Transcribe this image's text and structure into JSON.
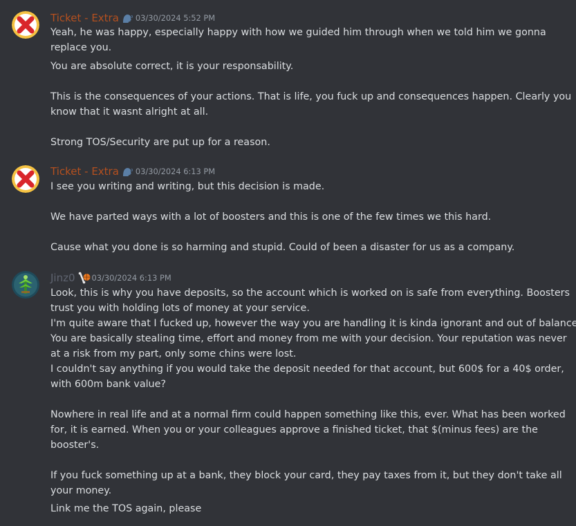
{
  "messages": [
    {
      "username": "Ticket - Extra",
      "username_color": "#b5501f",
      "timestamp": "03/30/2024 5:52 PM",
      "avatar_icon": "red-x-icon",
      "role_icon": "speaking-head-icon",
      "lines": [
        "Yeah, he was happy, especially happy with how we guided him through when we told him we gonna",
        "replace you.",
        "You are absolute correct, it is your responsability.",
        "",
        "This is the consequences of your actions. That is life, you fuck up and consequences happen. Clearly you",
        "know that it wasnt alright at all.",
        "",
        "Strong TOS/Security are put up for a reason."
      ]
    },
    {
      "username": "Ticket - Extra",
      "username_color": "#b5501f",
      "timestamp": "03/30/2024 6:13 PM",
      "avatar_icon": "red-x-icon",
      "role_icon": "speaking-head-icon",
      "lines": [
        "I see you writing and writing, but this decision is made.",
        "",
        "We have parted ways with a lot of boosters and this is one of the few times we this hard.",
        "",
        "Cause what you done is so harming and stupid. Could of been a disaster for us as a company."
      ]
    },
    {
      "username": "Jinz0",
      "username_color": "#5f6470",
      "timestamp": "03/30/2024 6:13 PM",
      "avatar_icon": "green-tree-avatar-icon",
      "role_icon": "bone-basketball-icon",
      "lines": [
        "Look, this is why you have deposits, so the account which is worked on is safe from everything. Boosters",
        "trust you with holding lots of money at your service.",
        "I'm quite aware that I fucked up, however the way you are handling it is kinda ignorant and out of balance.",
        "You are basically stealing time, effort and money from me with your decision. Your reputation was never",
        "at a risk from my part, only some chins were lost.",
        "I couldn't say anything if you would take the deposit needed for that account, but 600$ for a 40$ order,",
        "with 600m bank value?",
        "",
        "Nowhere in real life and at a normal firm could happen something like this, ever. What has been worked",
        "for, it is earned. When you or your colleagues approve a finished ticket, that $(minus fees) are the",
        "booster's.",
        "",
        "If you fuck something up at a bank, they block your card, they pay taxes from it, but they don't take all",
        "your money.",
        "Link me the TOS again, please"
      ]
    }
  ]
}
